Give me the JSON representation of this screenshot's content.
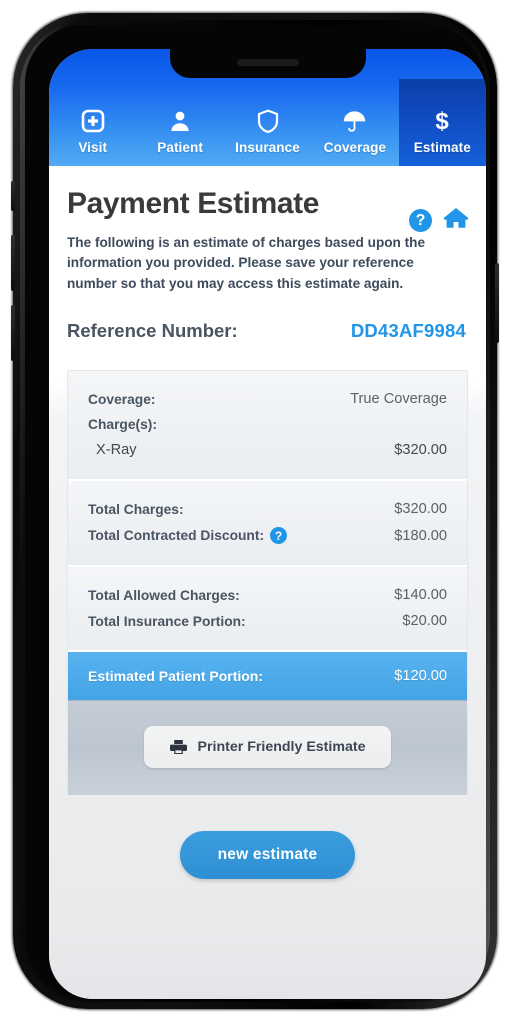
{
  "nav": {
    "items": [
      {
        "label": "Visit",
        "icon": "hospital-icon",
        "active": false
      },
      {
        "label": "Patient",
        "icon": "person-icon",
        "active": false
      },
      {
        "label": "Insurance",
        "icon": "shield-icon",
        "active": false
      },
      {
        "label": "Coverage",
        "icon": "umbrella-icon",
        "active": false
      },
      {
        "label": "Estimate",
        "icon": "dollar-icon",
        "active": true
      }
    ]
  },
  "header": {
    "title": "Payment Estimate",
    "help_icon": "help-circle-icon",
    "help_glyph": "?",
    "home_icon": "home-icon",
    "intro": "The following is an estimate of charges based upon the information you provided. Please save your reference number so that you may access this estimate again.",
    "reference_label": "Reference Number:",
    "reference_value": "DD43AF9984"
  },
  "estimate": {
    "coverage_label": "Coverage:",
    "coverage_value": "True Coverage",
    "charges_label": "Charge(s):",
    "charges": [
      {
        "name": "X-Ray",
        "amount": "$320.00"
      }
    ],
    "totals_a": [
      {
        "label": "Total Charges:",
        "amount": "$320.00",
        "help": false
      },
      {
        "label": "Total Contracted Discount:",
        "amount": "$180.00",
        "help": true,
        "help_glyph": "?"
      }
    ],
    "totals_b": [
      {
        "label": "Total Allowed Charges:",
        "amount": "$140.00"
      },
      {
        "label": "Total Insurance Portion:",
        "amount": "$20.00"
      }
    ],
    "patient_portion": {
      "label": "Estimated Patient Portion:",
      "amount": "$120.00"
    },
    "printer_button": {
      "label": "Printer Friendly Estimate",
      "icon": "printer-icon"
    }
  },
  "actions": {
    "new_estimate_label": "new estimate"
  },
  "colors": {
    "nav_blue": "#1769ef",
    "nav_active_blue": "#0f48bd",
    "accent_blue": "#2196e8",
    "highlight_row": "#43a4e6",
    "button_blue": "#2e90d4",
    "title_gray": "#3a3a3c",
    "label_slate": "#4a5562"
  }
}
